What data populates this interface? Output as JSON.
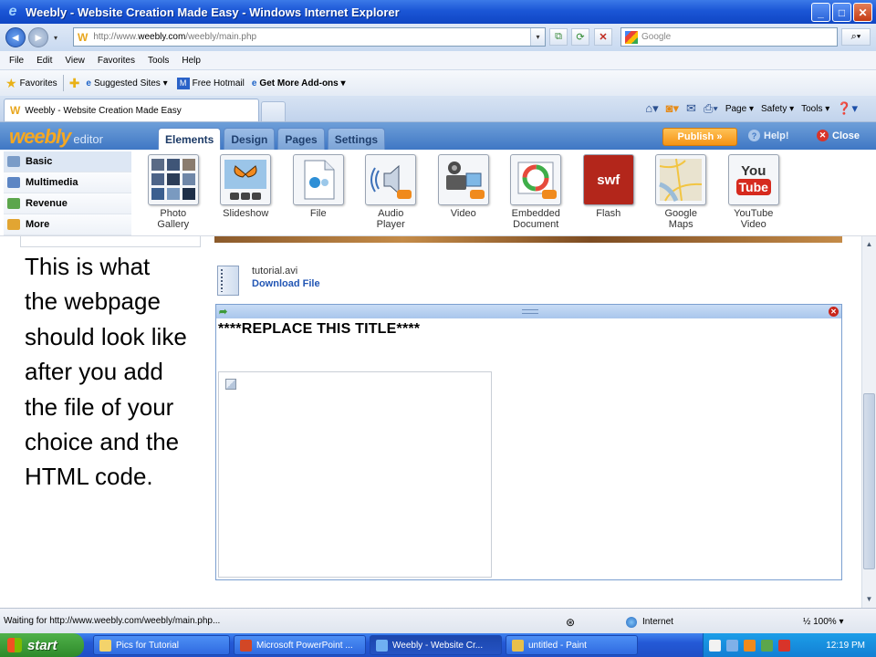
{
  "window": {
    "title": "Weebly - Website Creation Made Easy - Windows Internet Explorer"
  },
  "address": {
    "url_pre": "http://www.",
    "url_host": "weebly.com",
    "url_path": "/weebly/main.php",
    "search_placeholder": "Google"
  },
  "menu": [
    "File",
    "Edit",
    "View",
    "Favorites",
    "Tools",
    "Help"
  ],
  "favbar": {
    "favorites": "Favorites",
    "suggested": "Suggested Sites ▾",
    "hotmail": "Free Hotmail",
    "addons": "Get More Add-ons ▾"
  },
  "ietab": {
    "label": "Weebly - Website Creation Made Easy"
  },
  "commandbar": {
    "page": "Page ▾",
    "safety": "Safety ▾",
    "tools": "Tools ▾"
  },
  "weebly": {
    "logo": "weebly",
    "logo_suffix": "editor",
    "tabs": [
      "Elements",
      "Design",
      "Pages",
      "Settings"
    ],
    "publish": "Publish »",
    "help": "Help!",
    "close": "Close",
    "categories": [
      "Basic",
      "Multimedia",
      "Revenue",
      "More"
    ],
    "elements": [
      {
        "l1": "Photo",
        "l2": "Gallery"
      },
      {
        "l1": "Slideshow",
        "l2": ""
      },
      {
        "l1": "File",
        "l2": ""
      },
      {
        "l1": "Audio",
        "l2": "Player"
      },
      {
        "l1": "Video",
        "l2": ""
      },
      {
        "l1": "Embedded",
        "l2": "Document"
      },
      {
        "l1": "Flash",
        "l2": ""
      },
      {
        "l1": "Google",
        "l2": "Maps"
      },
      {
        "l1": "YouTube",
        "l2": "Video"
      }
    ],
    "swf_text": "swf",
    "youtube_text": "You",
    "youtube_text2": "Tube"
  },
  "content": {
    "note": "This is what the webpage should look like after you add the file of your choice and the HTML code.",
    "file_name": "tutorial.avi",
    "download": "Download File",
    "html_title": "****REPLACE THIS TITLE****"
  },
  "status": {
    "message": "Waiting for http://www.weebly.com/weebly/main.php...",
    "zone": "Internet",
    "zoom": "½ 100% ▾"
  },
  "taskbar": {
    "start": "start",
    "tasks": [
      "Pics for Tutorial",
      "Microsoft PowerPoint ...",
      "Weebly - Website Cr...",
      "untitled - Paint"
    ],
    "clock": "12:19 PM"
  }
}
